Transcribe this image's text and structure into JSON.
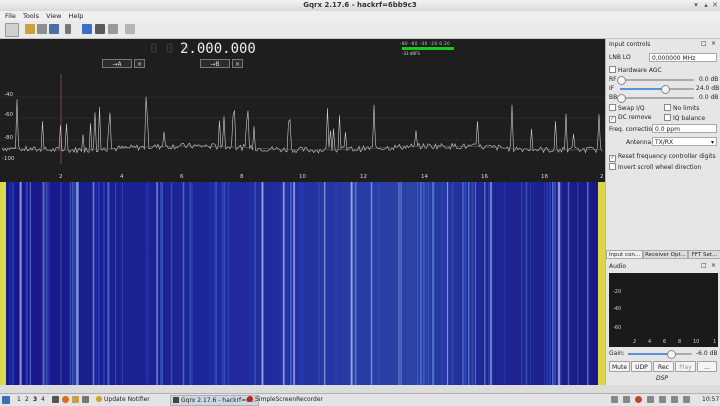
{
  "window": {
    "title": "Gqrx 2.17.6 - hackrf=6bb9c3"
  },
  "menu": [
    "File",
    "Tools",
    "View",
    "Help"
  ],
  "toolbar_icons": [
    "start-icon",
    "open-folder-icon",
    "open-icon",
    "save-icon",
    "record-icon",
    "screen-icon",
    "config-icon",
    "remote-icon",
    "network-icon"
  ],
  "frequency": {
    "dim_digits": "0 0 0",
    "value": "2.000.000"
  },
  "vfo": {
    "a_label": "→A",
    "b_label": "→B",
    "close": "×"
  },
  "smeter": {
    "ticks": [
      "-80",
      "-60",
      "-40",
      "-20",
      "0",
      "20"
    ],
    "reading": "-33 dBFS"
  },
  "fft": {
    "y_ticks": [
      "-40",
      "-60",
      "-80",
      "-100"
    ],
    "x_ticks": [
      "2",
      "4",
      "6",
      "8",
      "10",
      "12",
      "14",
      "16",
      "18",
      "2"
    ]
  },
  "side": {
    "title": "Input controls",
    "window_controls": [
      "□",
      "×"
    ],
    "lnb_label": "LNB LO",
    "lnb_value": "0,000000 MHz",
    "hw_agc": "Hardware AGC",
    "rf_label": "RF",
    "rf_value": "0.0 dB",
    "rf_level": 0.0,
    "if_label": "IF",
    "if_value": "24.0 dB",
    "if_level": 0.6,
    "bb_label": "BB",
    "bb_value": "0.0 dB",
    "bb_level": 0.0,
    "swap_iq": "Swap I/Q",
    "no_limits": "No limits",
    "dc_remove": "DC remove",
    "iq_balance": "IQ balance",
    "freq_corr_label": "Freq. correction",
    "freq_corr_value": "0.0 ppm",
    "antenna_label": "Antenna",
    "antenna_value": "TX/RX",
    "reset_freq": "Reset frequency controller digits",
    "invert_scroll": "Invert scroll wheel direction",
    "check_mark": "✓",
    "tabs": [
      "Input con...",
      "Receiver Opt...",
      "FFT Set..."
    ]
  },
  "audio": {
    "title": "Audio",
    "y_ticks": [
      "-20",
      "-40",
      "-60"
    ],
    "x_ticks": [
      "2",
      "4",
      "6",
      "8",
      "10",
      "1"
    ],
    "gain_label": "Gain:",
    "gain_value": "-6.0 dB",
    "gain_level": 0.65,
    "buttons": [
      "Mute",
      "UDP",
      "Rec",
      "Play",
      "..."
    ],
    "dsp": "DSP"
  },
  "taskbar": {
    "workspaces": [
      "1",
      "2",
      "3",
      "4"
    ],
    "items": [
      "Update Notifier",
      "Gqrx 2.17.6 - hackrf=6...",
      "SimpleScreenRecorder"
    ],
    "clock": "10:57"
  },
  "colors": {
    "waterfall_bg": "#15156a",
    "fft_bg": "#1e1e1e",
    "accent": "#5b8fd6",
    "smeter_green": "#19c819"
  }
}
